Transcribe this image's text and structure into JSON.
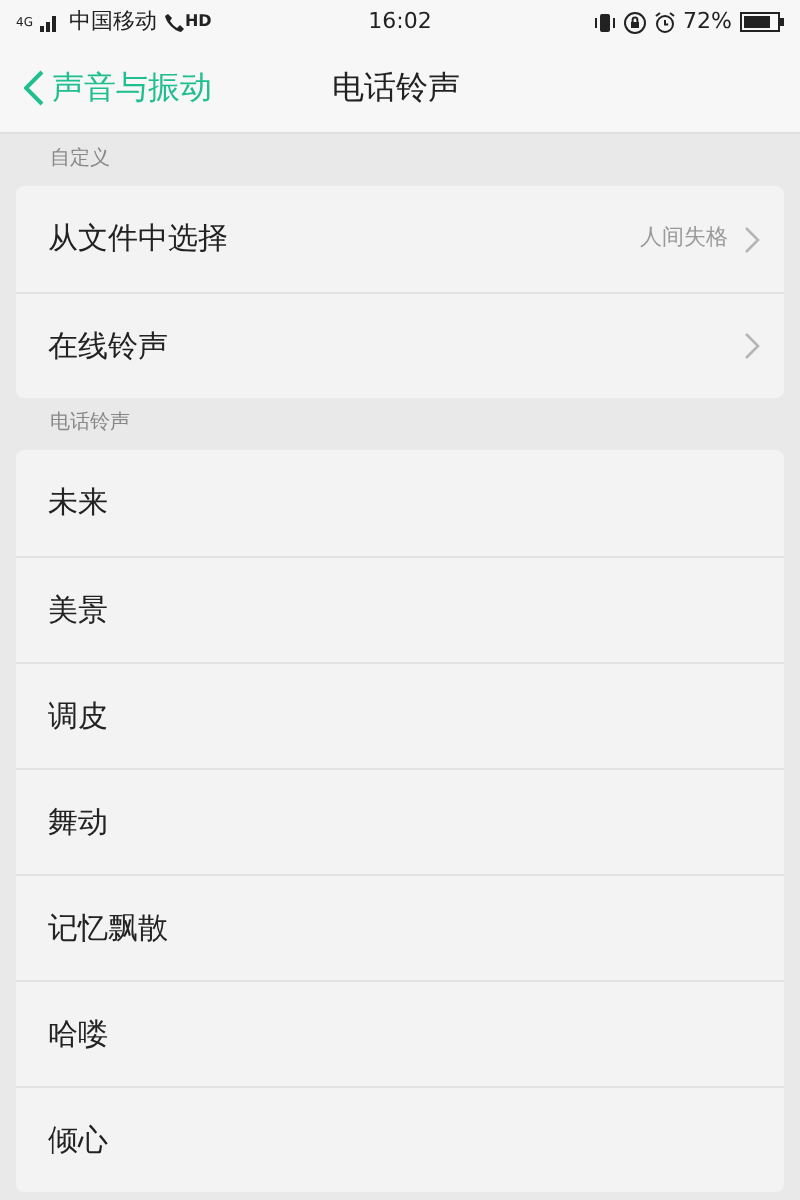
{
  "status_bar": {
    "network": "4G",
    "carrier": "中国移动",
    "call_badge": "HD",
    "time": "16:02",
    "battery": "72%"
  },
  "header": {
    "back_label": "声音与振动",
    "title": "电话铃声"
  },
  "sections": [
    {
      "label": "自定义",
      "items": [
        {
          "label": "从文件中选择",
          "value": "人间失格",
          "chevron": true
        },
        {
          "label": "在线铃声",
          "chevron": true
        }
      ]
    },
    {
      "label": "电话铃声",
      "items": [
        {
          "label": "未来",
          "chevron": false
        },
        {
          "label": "美景",
          "chevron": false
        },
        {
          "label": "调皮",
          "chevron": false
        },
        {
          "label": "舞动",
          "chevron": false
        },
        {
          "label": "记忆飘散",
          "chevron": false
        },
        {
          "label": "哈喽",
          "chevron": false
        },
        {
          "label": "倾心",
          "chevron": false
        }
      ]
    }
  ]
}
